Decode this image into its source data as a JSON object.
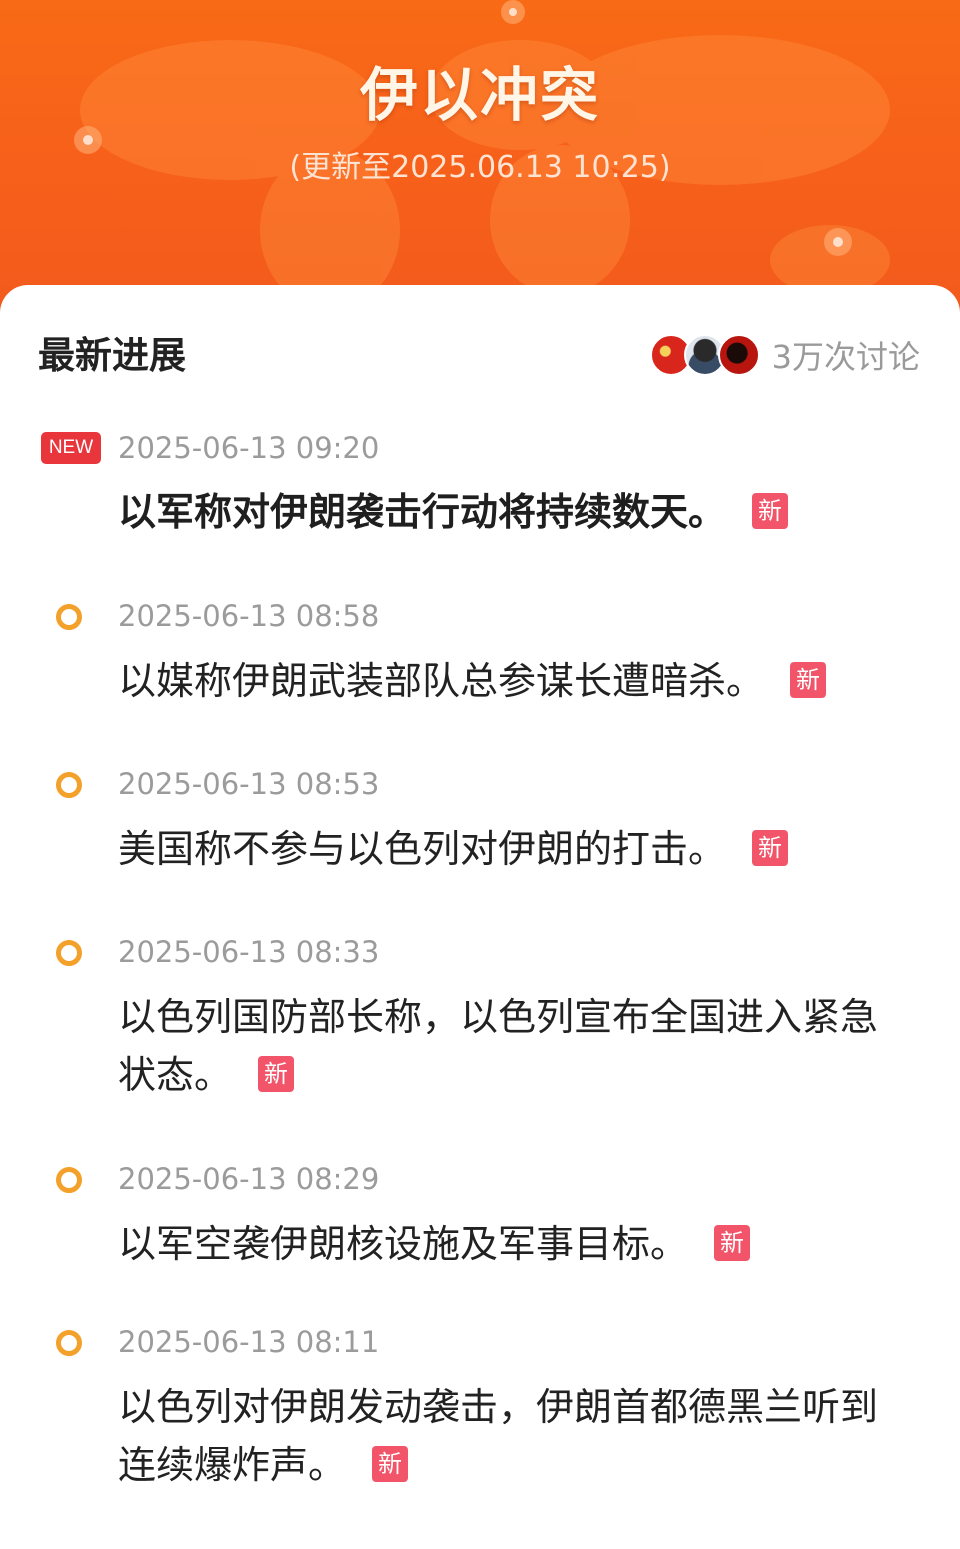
{
  "header": {
    "title": "伊以冲突",
    "updated": "(更新至2025.06.13 10:25)"
  },
  "section": {
    "title": "最新进展",
    "discussion_count": "3万次讨论"
  },
  "entries": [
    {
      "time": "2025-06-13 09:20",
      "text": "以军称对伊朗袭击行动将持续数天。",
      "tag": "新",
      "latest_badge": "NEW"
    },
    {
      "time": "2025-06-13 08:58",
      "text": "以媒称伊朗武装部队总参谋长遭暗杀。",
      "tag": "新"
    },
    {
      "time": "2025-06-13 08:53",
      "text": "美国称不参与以色列对伊朗的打击。",
      "tag": "新"
    },
    {
      "time": "2025-06-13 08:33",
      "text": "以色列国防部长称，以色列宣布全国进入紧急状态。",
      "tag": "新"
    },
    {
      "time": "2025-06-13 08:29",
      "text": "以军空袭伊朗核设施及军事目标。",
      "tag": "新"
    },
    {
      "time": "2025-06-13 08:11",
      "text": "以色列对伊朗发动袭击，伊朗首都德黑兰听到连续爆炸声。",
      "tag": "新"
    }
  ],
  "colors": {
    "header_orange": "#f7611a",
    "new_badge": "#e8363c",
    "xin_tag": "#f2556a",
    "timeline_dot": "#f3a12a"
  }
}
